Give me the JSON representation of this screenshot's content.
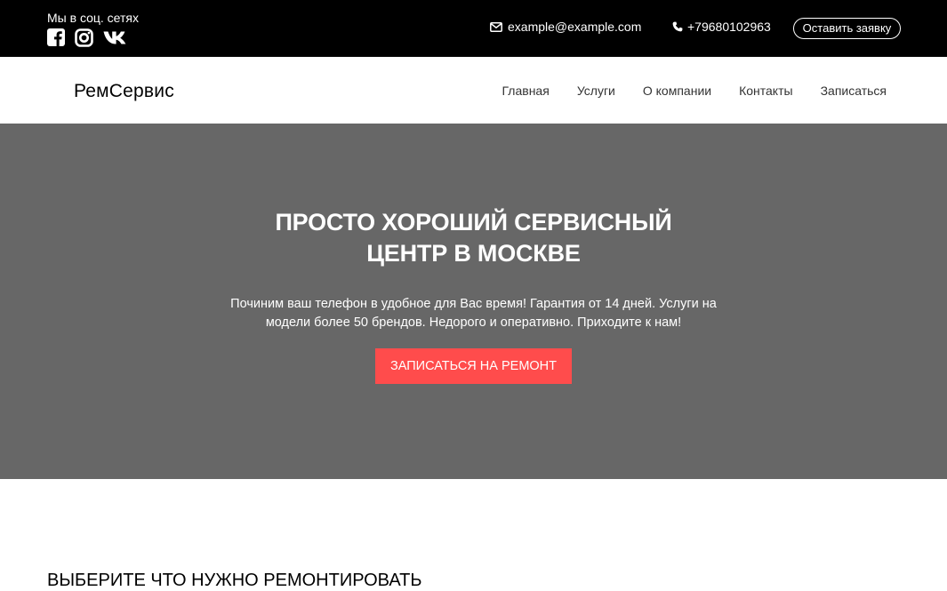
{
  "topbar": {
    "social_label": "Мы в соц. сетях",
    "social_icons": [
      "facebook-icon",
      "instagram-icon",
      "vk-icon"
    ],
    "email": "example@example.com",
    "phone": "+79680102963",
    "request_button": "Оставить заявку"
  },
  "navbar": {
    "logo": "РемСервис",
    "items": [
      {
        "label": "Главная"
      },
      {
        "label": "Услуги"
      },
      {
        "label": "О компании"
      },
      {
        "label": "Контакты"
      },
      {
        "label": "Записаться"
      }
    ]
  },
  "hero": {
    "title": "ПРОСТО ХОРОШИЙ СЕРВИСНЫЙ ЦЕНТР В МОСКВЕ",
    "text": "Починим ваш телефон в удобное для Вас время! Гарантия от 14 дней. Услуги на модели более 50 брендов. Недорого и оперативно. Приходите к нам!",
    "button": "ЗАПИСАТЬСЯ НА РЕМОНТ"
  },
  "section": {
    "title": "ВЫБЕРИТЕ ЧТО НУЖНО РЕМОНТИРОВАТЬ"
  },
  "colors": {
    "topbar_bg": "#000000",
    "hero_bg": "#676767",
    "accent": "#ff4c4c"
  }
}
